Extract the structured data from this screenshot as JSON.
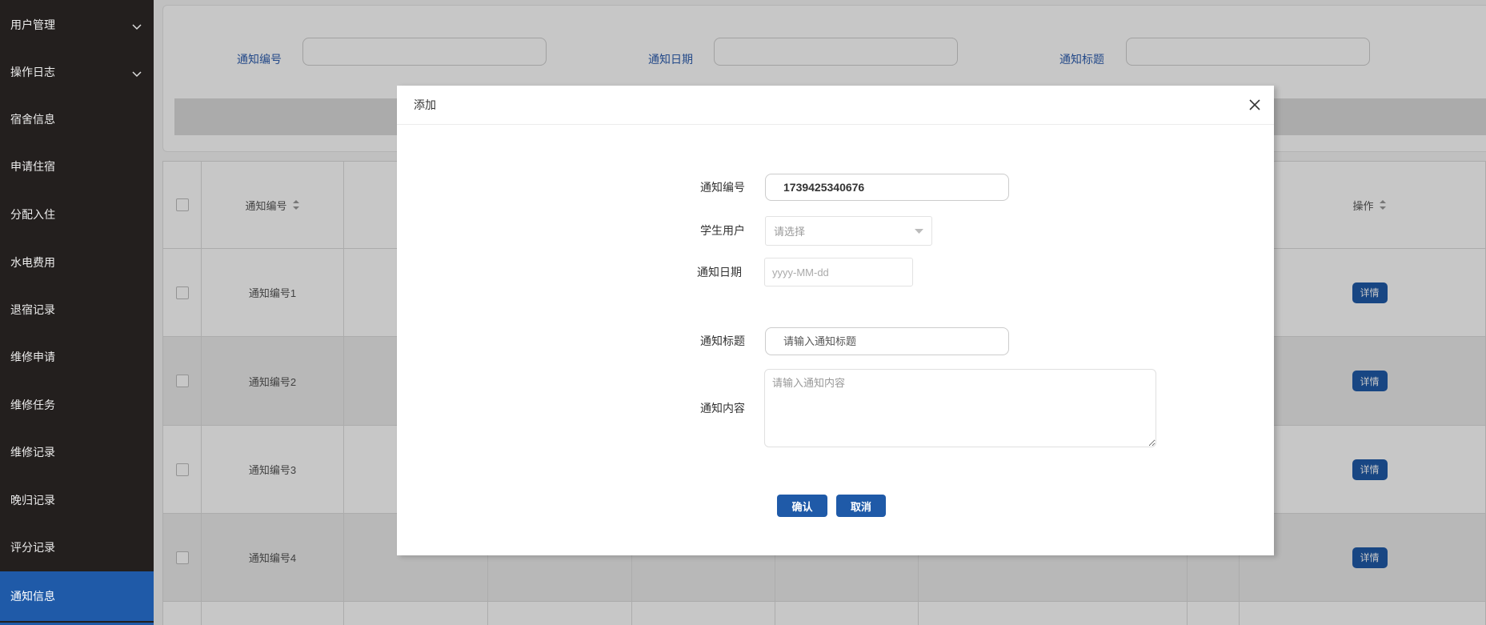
{
  "sidebar": {
    "items": [
      {
        "label": "用户管理",
        "icon": "chevron-down-icon"
      },
      {
        "label": "操作日志",
        "icon": "chevron-down-icon"
      },
      {
        "label": "宿舍信息"
      },
      {
        "label": "申请住宿"
      },
      {
        "label": "分配入住"
      },
      {
        "label": "水电费用"
      },
      {
        "label": "退宿记录"
      },
      {
        "label": "维修申请"
      },
      {
        "label": "维修任务"
      },
      {
        "label": "维修记录"
      },
      {
        "label": "晚归记录"
      },
      {
        "label": "评分记录"
      },
      {
        "label": "通知信息",
        "active": true
      }
    ]
  },
  "search": {
    "notice_no": {
      "label": "通知编号"
    },
    "notice_date": {
      "label": "通知日期"
    },
    "notice_title": {
      "label": "通知标题"
    }
  },
  "table": {
    "headers": {
      "notice_no": "通知编号",
      "actions": "操作"
    },
    "rows": [
      {
        "notice_no": "通知编号1",
        "action": "详情"
      },
      {
        "notice_no": "通知编号2",
        "action": "详情"
      },
      {
        "notice_no": "通知编号3",
        "action": "详情"
      },
      {
        "notice_no": "通知编号4",
        "action": "详情"
      }
    ]
  },
  "dialog": {
    "title": "添加",
    "fields": {
      "notice_no": {
        "label": "通知编号",
        "value": "1739425340676"
      },
      "student_user": {
        "label": "学生用户",
        "placeholder": "请选择"
      },
      "notice_date": {
        "label": "通知日期",
        "placeholder": "yyyy-MM-dd"
      },
      "notice_title": {
        "label": "通知标题",
        "placeholder": "请输入通知标题"
      },
      "notice_content": {
        "label": "通知内容",
        "placeholder": "请输入通知内容"
      }
    },
    "buttons": {
      "confirm": "确认",
      "cancel": "取消"
    }
  },
  "colors": {
    "sidebar_bg": "#231f1e",
    "accent": "#1f5aa8",
    "label_blue": "#2f5fb0"
  }
}
